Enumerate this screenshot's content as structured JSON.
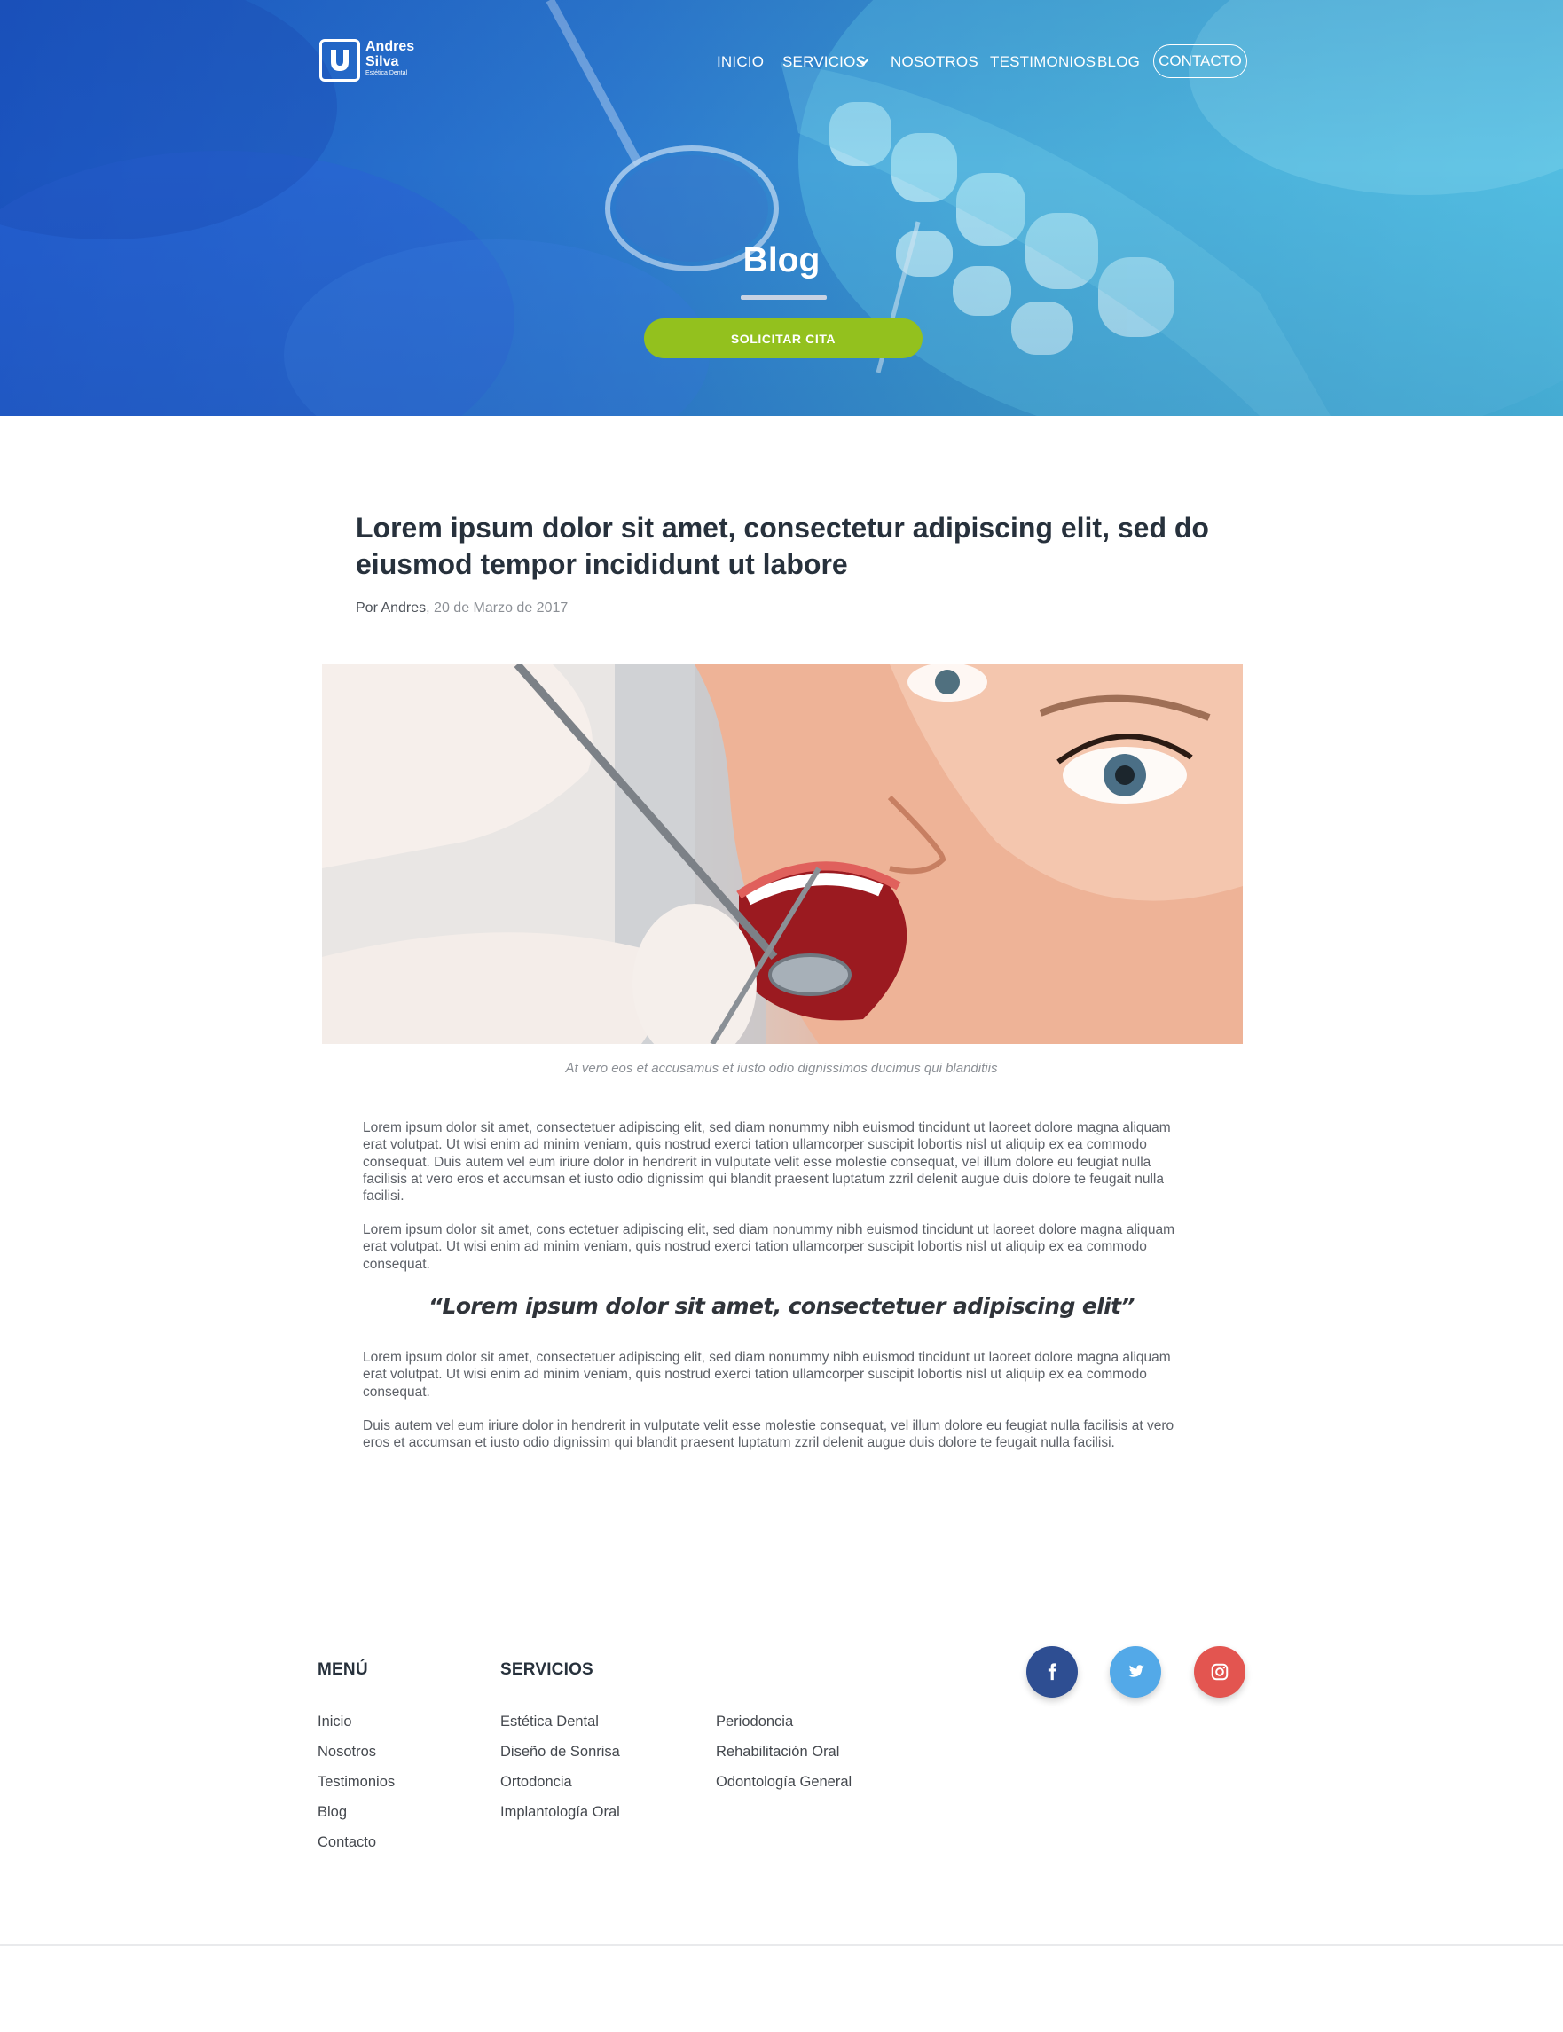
{
  "brand": {
    "name_line1": "Andres",
    "name_line2": "Silva",
    "tagline": "Estética Dental"
  },
  "nav": {
    "items": [
      "INICIO",
      "SERVICIOS",
      "NOSOTROS",
      "TESTIMONIOS",
      "BLOG"
    ],
    "contact": "CONTACTO"
  },
  "hero": {
    "title": "Blog",
    "cta": "SOLICITAR CITA"
  },
  "post": {
    "title": "Lorem ipsum dolor sit amet, consectetur adipiscing elit, sed do eiusmod tempor incididunt ut labore",
    "byline_prefix": "Por Andres",
    "date": ", 20 de Marzo de 2017",
    "caption": "At vero eos et accusamus et iusto odio dignissimos ducimus qui blanditiis",
    "paragraphs": [
      "Lorem ipsum dolor sit amet, consectetuer adipiscing elit, sed diam nonummy nibh euismod tincidunt ut laoreet dolore magna aliquam erat volutpat. Ut wisi enim ad minim veniam, quis nostrud exerci tation ullamcorper suscipit lobortis nisl ut aliquip ex ea commodo consequat. Duis autem vel eum iriure dolor in hendrerit in vulputate velit esse molestie consequat, vel illum dolore eu feugiat nulla facilisis at vero eros et accumsan et iusto odio dignissim qui blandit praesent luptatum zzril delenit augue duis dolore te feugait nulla facilisi.",
      "Lorem ipsum dolor sit amet, cons ectetuer adipiscing elit, sed diam nonummy nibh euismod tincidunt ut laoreet dolore magna aliquam erat volutpat. Ut wisi enim ad minim veniam, quis nostrud exerci tation ullamcorper suscipit lobortis nisl ut aliquip ex ea commodo consequat.",
      "Lorem ipsum dolor sit amet, consectetuer adipiscing elit, sed diam nonummy nibh euismod tincidunt ut laoreet dolore magna aliquam erat volutpat. Ut wisi enim ad minim veniam, quis nostrud exerci tation ullamcorper suscipit lobortis nisl ut aliquip ex ea commodo consequat.",
      "Duis autem vel eum iriure dolor in hendrerit in vulputate velit esse molestie consequat, vel illum dolore eu feugiat nulla facilisis at vero eros et accumsan et iusto odio dignissim qui blandit praesent luptatum zzril delenit augue duis dolore te feugait nulla facilisi."
    ],
    "quote": "“Lorem ipsum dolor sit amet, consectetuer adipiscing elit”"
  },
  "footer": {
    "menu_title": "MENÚ",
    "menu": [
      "Inicio",
      "Nosotros",
      "Testimonios",
      "Blog",
      "Contacto"
    ],
    "services_title": "SERVICIOS",
    "services_col1": [
      "Estética Dental",
      "Diseño de Sonrisa",
      "Ortodoncia",
      "Implantología Oral"
    ],
    "services_col2": [
      "Periodoncia",
      "Rehabilitación Oral",
      "Odontología General"
    ],
    "social": [
      "facebook-icon",
      "twitter-icon",
      "instagram-icon"
    ]
  },
  "colors": {
    "hero_start": "#1a56c4",
    "hero_end": "#4dbde0",
    "cta": "#93c11e",
    "heading": "#27313c",
    "facebook": "#2e4e92",
    "twitter": "#53a9e8",
    "instagram": "#e35550"
  }
}
